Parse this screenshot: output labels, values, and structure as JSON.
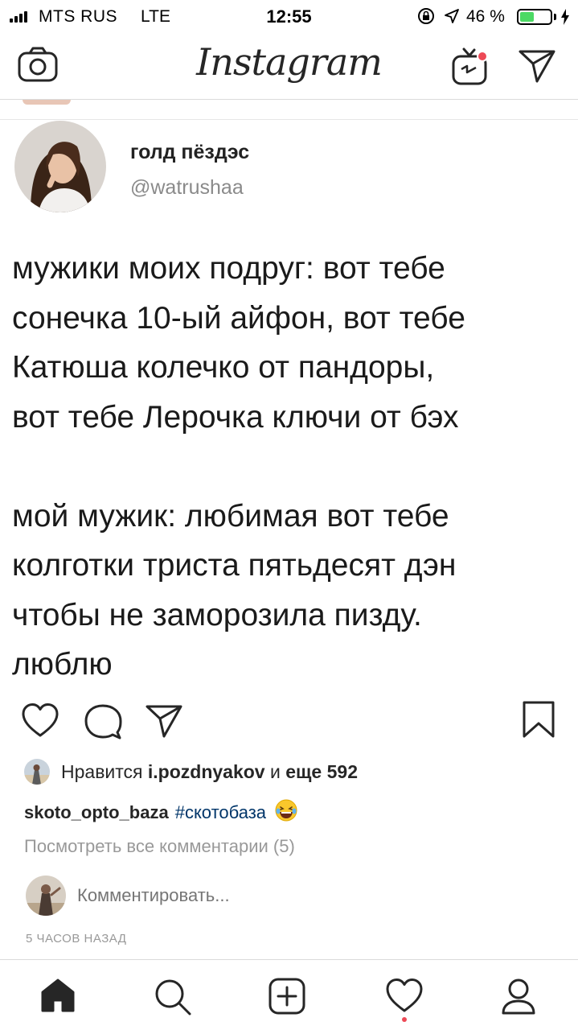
{
  "status_bar": {
    "carrier": "MTS RUS",
    "network": "LTE",
    "time": "12:55",
    "battery_percent": "46 %",
    "battery_level": 0.46
  },
  "nav": {
    "logo_text": "Instagram",
    "icons": [
      "camera-icon",
      "igtv-icon",
      "direct-message-icon"
    ]
  },
  "tweet": {
    "display_name": "голд пёздэс",
    "handle": "@watrushaa",
    "lines": [
      "мужики моих подруг: вот тебе",
      "сонечка 10-ый айфон, вот тебе",
      "Катюша колечко от пандоры,",
      "вот тебе Лерочка ключи от бэх",
      "",
      "мой мужик: любимая вот тебе",
      "колготки триста пятьдесят дэн",
      "чтобы не заморозила пизду.",
      "люблю"
    ]
  },
  "post": {
    "likes_prefix": "Нравится",
    "likes_user": "i.pozdnyakov",
    "likes_middle": "и",
    "likes_more": "еще 592",
    "caption_user": "skoto_opto_baza",
    "caption_hashtag": "#скотобаза",
    "caption_emoji": "😂",
    "view_comments": "Посмотреть все комментарии (5)",
    "comment_placeholder": "Комментировать...",
    "timestamp": "5 ЧАСОВ НАЗАД"
  },
  "tab_bar": {
    "tabs": [
      "home",
      "search",
      "new-post",
      "activity",
      "profile"
    ],
    "active": "home"
  },
  "colors": {
    "hashtag": "#003569",
    "muted": "#999999",
    "notification": "#ed4956",
    "battery": "#4cd964"
  }
}
